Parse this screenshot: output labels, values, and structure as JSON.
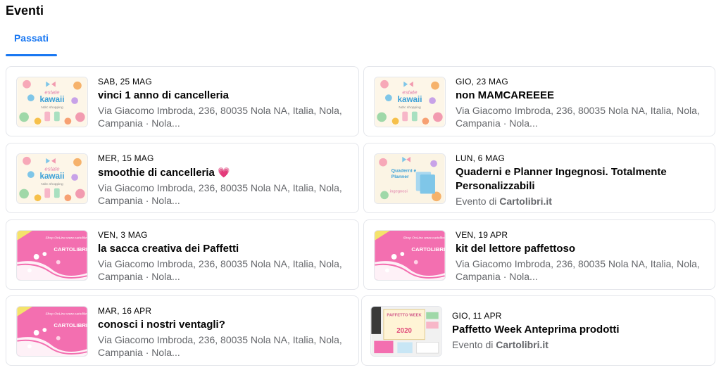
{
  "page": {
    "title": "Eventi"
  },
  "tabs": [
    {
      "label": "Passati",
      "active": true
    }
  ],
  "colors": {
    "accent": "#1877f2",
    "secondary_text": "#65676b",
    "card_border": "#e4e6eb"
  },
  "events": [
    {
      "date": "SAB, 25 MAG",
      "title": "vinci 1 anno di cancelleria",
      "loc1": "Via Giacomo Imbroda, 236, 80035 Nola NA, Italia, Nola,",
      "loc2": "Campania · Nola...",
      "thumb": "kawaii"
    },
    {
      "date": "GIO, 23 MAG",
      "title": "non MAMCAREEEE",
      "loc1": "Via Giacomo Imbroda, 236, 80035 Nola NA, Italia, Nola,",
      "loc2": "Campania · Nola...",
      "thumb": "kawaii"
    },
    {
      "date": "MER, 15 MAG",
      "title": "smoothie di cancelleria",
      "title_emoji": "💗",
      "loc1": "Via Giacomo Imbroda, 236, 80035 Nola NA, Italia, Nola,",
      "loc2": "Campania · Nola...",
      "thumb": "kawaii"
    },
    {
      "date": "LUN, 6 MAG",
      "title": "Quaderni e Planner Ingegnosi. Totalmente Personalizzabili",
      "by_prefix": "Evento di",
      "by_name": "Cartolibri.it",
      "thumb": "quaderni"
    },
    {
      "date": "VEN, 3 MAG",
      "title": "la sacca creativa dei Paffetti",
      "loc1": "Via Giacomo Imbroda, 236, 80035 Nola NA, Italia, Nola,",
      "loc2": "Campania · Nola...",
      "thumb": "pink"
    },
    {
      "date": "VEN, 19 APR",
      "title": "kit del lettore paffettoso",
      "loc1": "Via Giacomo Imbroda, 236, 80035 Nola NA, Italia, Nola,",
      "loc2": "Campania · Nola...",
      "thumb": "pink"
    },
    {
      "date": "MAR, 16 APR",
      "title": "conosci i nostri ventagli?",
      "loc1": "Via Giacomo Imbroda, 236, 80035 Nola NA, Italia, Nola,",
      "loc2": "Campania · Nola...",
      "thumb": "pink"
    },
    {
      "date": "GIO, 11 APR",
      "title": "Paffetto Week Anteprima prodotti",
      "by_prefix": "Evento di",
      "by_name": "Cartolibri.it",
      "thumb": "week"
    }
  ],
  "thumb_text": {
    "kawaii": {
      "line1": "estate",
      "line2": "kawaii",
      "line3": "Ndrc shopping"
    },
    "quaderni": {
      "line1": "Quaderni e",
      "line2": "Planner",
      "line3": "ingegnosi"
    },
    "pink": {
      "line1": "Shop OnLine www.cartolibri",
      "line2": "CARTOLIBRI"
    },
    "week": {
      "line1": "PAFFETTO WEEK",
      "line2": "2020"
    }
  }
}
